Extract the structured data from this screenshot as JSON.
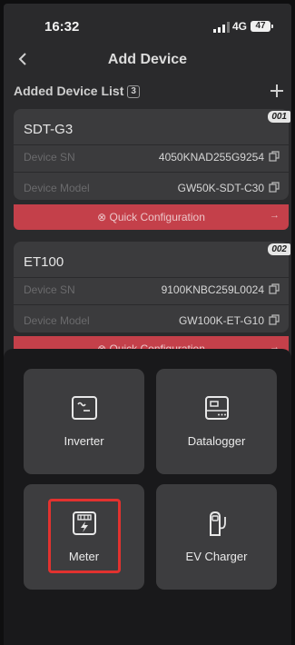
{
  "status_bar": {
    "time": "16:32",
    "network": "4G",
    "battery": "47"
  },
  "header": {
    "title": "Add Device"
  },
  "device_list": {
    "title": "Added Device List",
    "count": "3",
    "devices": [
      {
        "name": "SDT-G3",
        "index": "001",
        "sn_label": "Device SN",
        "sn": "4050KNAD255G9254",
        "model_label": "Device Model",
        "model": "GW50K-SDT-C30",
        "quick_config": "Quick Configuration"
      },
      {
        "name": "ET100",
        "index": "002",
        "sn_label": "Device SN",
        "sn": "9100KNBC259L0024",
        "model_label": "Device Model",
        "model": "GW100K-ET-G10",
        "quick_config": "Quick Configuration"
      }
    ]
  },
  "device_types": [
    {
      "label": "Inverter",
      "icon": "inverter-icon"
    },
    {
      "label": "Datalogger",
      "icon": "datalogger-icon"
    },
    {
      "label": "Meter",
      "icon": "meter-icon"
    },
    {
      "label": "EV Charger",
      "icon": "ev-charger-icon"
    }
  ]
}
